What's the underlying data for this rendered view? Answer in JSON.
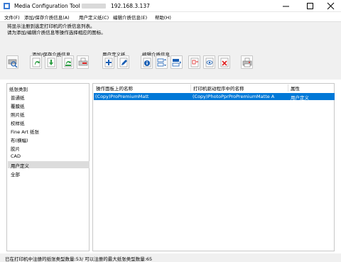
{
  "window": {
    "title": "Media Configuration Tool",
    "printer_ip": "192.168.3.137"
  },
  "menu": [
    "文件(F)",
    "添加/保存介质信息(A)",
    "用户定义纸(C)",
    "编辑介质信息(E)",
    "帮助(H)"
  ],
  "instructions": [
    "将显示注册到选定打印机的介质信息列表。",
    "请为添加/编辑介质信息等操作选择相应的图标。"
  ],
  "toolbar": {
    "groups": [
      "添加/保存介质信息",
      "用户定义纸",
      "编辑介质信息"
    ]
  },
  "left_panel": {
    "header": "纸张类别",
    "items": [
      "普通纸",
      "覆膜纸",
      "照片纸",
      "校样纸",
      "Fine Art 纸张",
      "布(横幅)",
      "胶片",
      "CAD",
      "用户定义",
      "全部"
    ],
    "selected": "用户定义"
  },
  "table": {
    "columns": [
      "操作面板上的名称",
      "打印机驱动程序中的名称",
      "属性"
    ],
    "rows": [
      [
        "(Copy)ProPremiumMatt",
        "(Copy)PhotoPprProPremiumMatte A",
        "用户定义"
      ]
    ]
  },
  "status": "已在打印机中注册的纸张类型数量:53/ 可以注册的最大纸张类型数量:65"
}
